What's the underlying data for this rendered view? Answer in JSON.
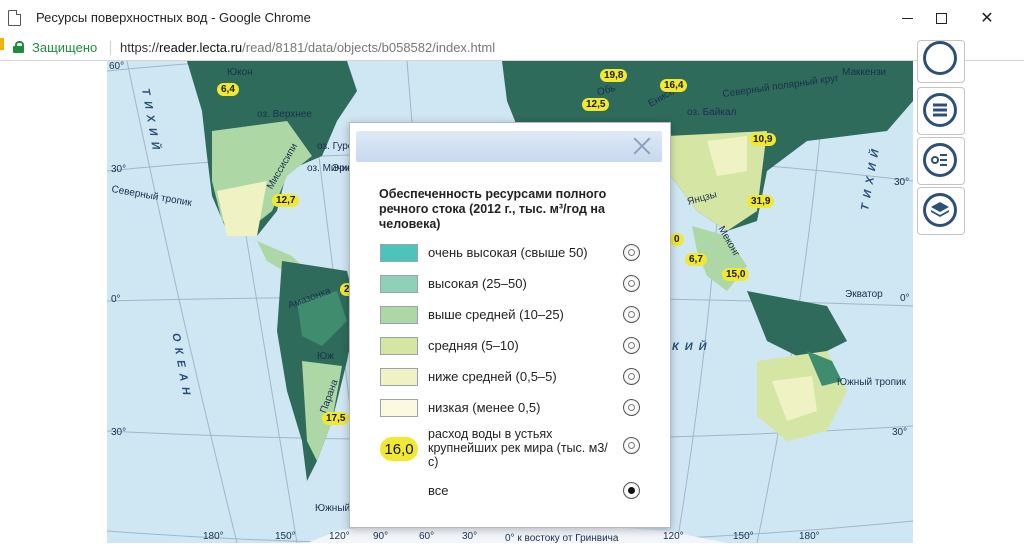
{
  "window": {
    "title": "Ресурсы поверхностных вод - Google Chrome",
    "minimize_glyph": "–",
    "maximize_glyph": "☐",
    "close_glyph": "✕"
  },
  "addressbar": {
    "secure_label": "Защищено",
    "url_scheme": "https://",
    "url_host": "reader.lecta.ru",
    "url_path": "/read/8181/data/objects/b058582/index.html"
  },
  "map": {
    "place_labels": [
      "Юкон",
      "оз. Верхнее",
      "оз. Гурон",
      "оз. Мичиган",
      "Миссисипи",
      "Северный тропик",
      "Амазонка",
      "Парана",
      "Юж",
      "Экватор",
      "Южный тропик",
      "Обь",
      "Енисей",
      "оз. Байкал",
      "Северный полярный круг",
      "Маккензи",
      "Янцзы",
      "Меконг",
      "Эри",
      "Южный"
    ],
    "ocean_labels": [
      "ТИХИЙ",
      "ОКЕАН",
      "ТИХИЙ",
      "КИЙ"
    ],
    "grid_labels": [
      "60°",
      "30°",
      "0°",
      "30°",
      "30°",
      "0°",
      "30°",
      "180°",
      "150°",
      "120°",
      "90°",
      "60°",
      "30°",
      "0° к востоку от Гринвича",
      "120°",
      "150°",
      "180°"
    ],
    "flow_badges": [
      "6,4",
      "12,7",
      "2",
      "17,5",
      "19,8",
      "12,5",
      "16,4",
      "10,9",
      "31,9",
      "6,7",
      "15,0",
      "0"
    ],
    "colors": {
      "ocean": "#cfe6f3",
      "very_high": "#4cc4bb",
      "high": "#8fd0b8",
      "above_avg": "#aed7a6",
      "medium": "#d5e6a4",
      "below_avg": "#eff3c4",
      "low": "#fbf9df",
      "dark_green": "#2e6b5b",
      "flow_badge": "#f1e832"
    }
  },
  "toolbar": {
    "help_icon": "help-icon",
    "menu_icon": "menu-icon",
    "legend_icon": "legend-icon",
    "layers_icon": "layers-icon"
  },
  "legend": {
    "title": "Обеспеченность ресурсами полного речного стока (2012 г., тыс. м³/год на человека)",
    "items": [
      {
        "label": "очень высокая (свыше 50)",
        "color": "#4cc4bb",
        "selected": false
      },
      {
        "label": "высокая (25–50)",
        "color": "#8fd0b8",
        "selected": false
      },
      {
        "label": "выше средней (10–25)",
        "color": "#aed7a6",
        "selected": false
      },
      {
        "label": "средняя (5–10)",
        "color": "#d5e6a4",
        "selected": false
      },
      {
        "label": "ниже средней (0,5–5)",
        "color": "#eff3c4",
        "selected": false
      },
      {
        "label": "низкая (менее 0,5)",
        "color": "#fbf9df",
        "selected": false
      }
    ],
    "flow": {
      "badge": "16,0",
      "label": "расход воды в устьях крупнейших рек мира (тыс. м3/с)",
      "selected": false
    },
    "all": {
      "label": "все",
      "selected": true
    }
  }
}
